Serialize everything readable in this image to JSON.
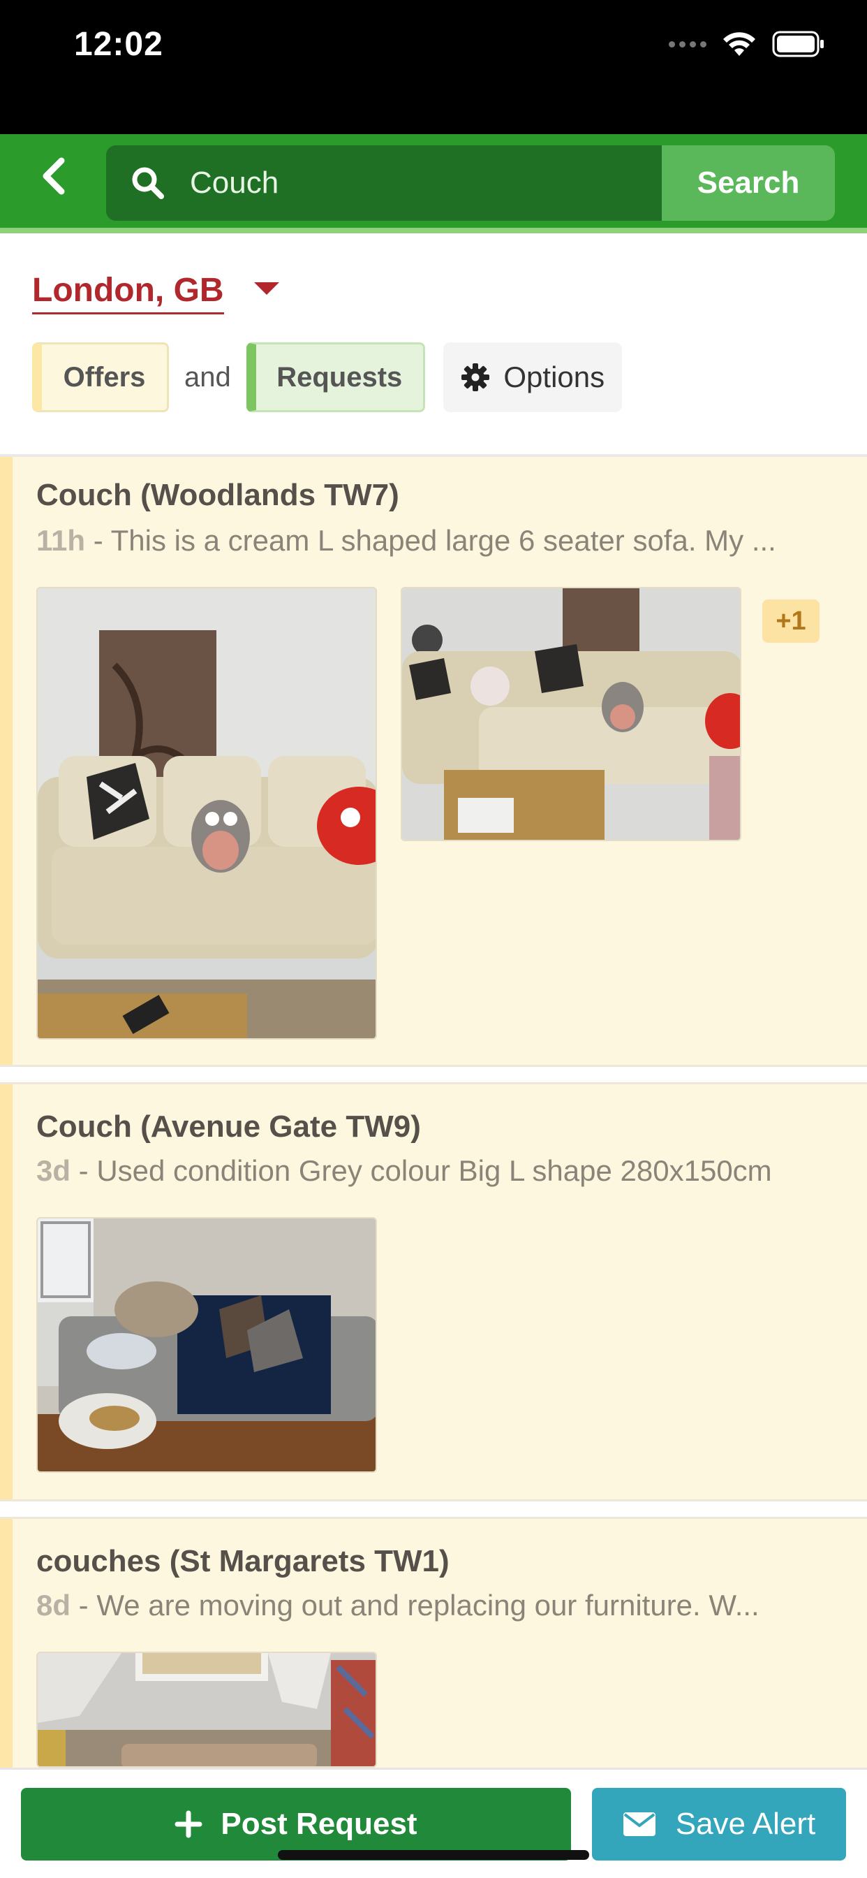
{
  "status_bar": {
    "time": "12:02"
  },
  "header": {
    "search_value": "Couch",
    "search_button": "Search"
  },
  "filters": {
    "location": "London, GB",
    "offers": "Offers",
    "and": "and",
    "requests": "Requests",
    "options": "Options"
  },
  "listings": [
    {
      "title": "Couch (Woodlands TW7)",
      "age": "11h",
      "description": " - This is a cream L shaped large 6 seater sofa. My ...",
      "more_photos": "+1"
    },
    {
      "title": "Couch (Avenue Gate TW9)",
      "age": "3d",
      "description": " - Used condition Grey colour Big L shape 280x150cm"
    },
    {
      "title": "couches (St Margarets TW1)",
      "age": "8d",
      "description": " - We are moving out and replacing our furniture. W..."
    }
  ],
  "bottom_bar": {
    "post_request": "Post Request",
    "save_alert": "Save Alert"
  },
  "colors": {
    "header_green": "#2b9b2b",
    "location_red": "#b0282c",
    "listing_bg": "#fdf7e0",
    "post_request_green": "#218a3a",
    "save_alert_teal": "#33a6bb"
  },
  "icons": [
    "back-chevron-icon",
    "search-icon",
    "gear-icon",
    "caret-down-icon",
    "plus-icon",
    "envelope-icon",
    "wifi-icon",
    "battery-icon"
  ]
}
